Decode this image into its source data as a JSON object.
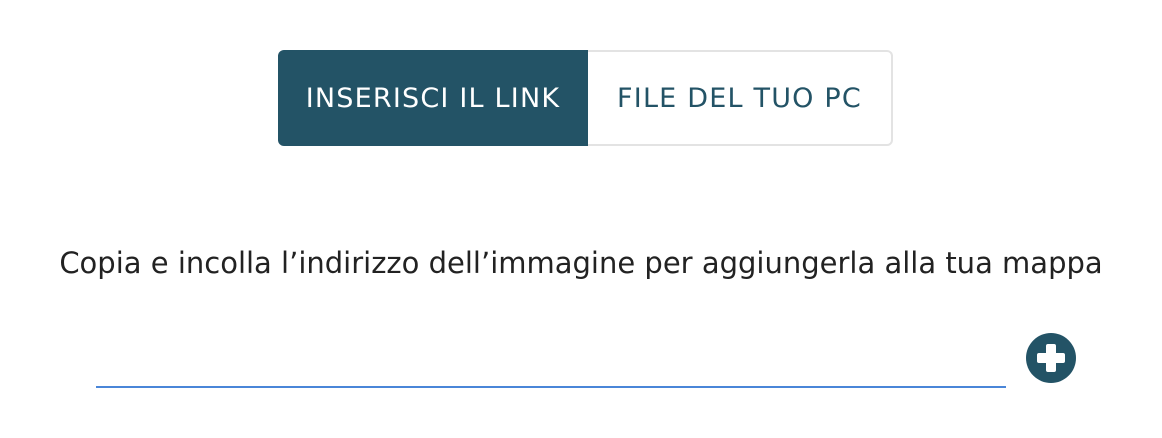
{
  "tabs": {
    "link_label": "INSERISCI IL LINK",
    "file_label": "FILE DEL TUO PC",
    "active": "link"
  },
  "instruction": "Copia e incolla l’indirizzo dell’immagine per aggiungerla alla tua mappa",
  "url_input": {
    "value": "",
    "placeholder": ""
  },
  "add_button": {
    "icon": "plus-circle-icon"
  },
  "colors": {
    "primary": "#235366",
    "input_underline": "#4a86d8",
    "tab_border": "#e3e3e3"
  }
}
